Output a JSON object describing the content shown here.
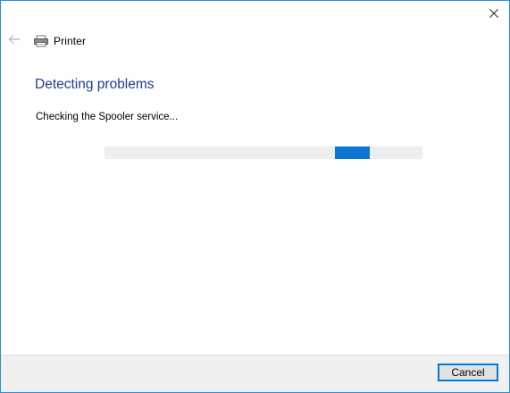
{
  "window": {
    "title": "Printer",
    "accent_color": "#0078d7"
  },
  "nav": {
    "back_icon": "back-arrow-icon",
    "close_icon": "close-icon",
    "app_icon": "printer-icon"
  },
  "main": {
    "heading": "Detecting problems",
    "status": "Checking the Spooler service..."
  },
  "progress": {
    "type": "indeterminate-marquee",
    "chunk_start_fraction": 0.724,
    "chunk_width_fraction": 0.11,
    "chunk_color": "#0a76d2",
    "track_color": "#eeeeee"
  },
  "footer": {
    "cancel_label": "Cancel"
  }
}
